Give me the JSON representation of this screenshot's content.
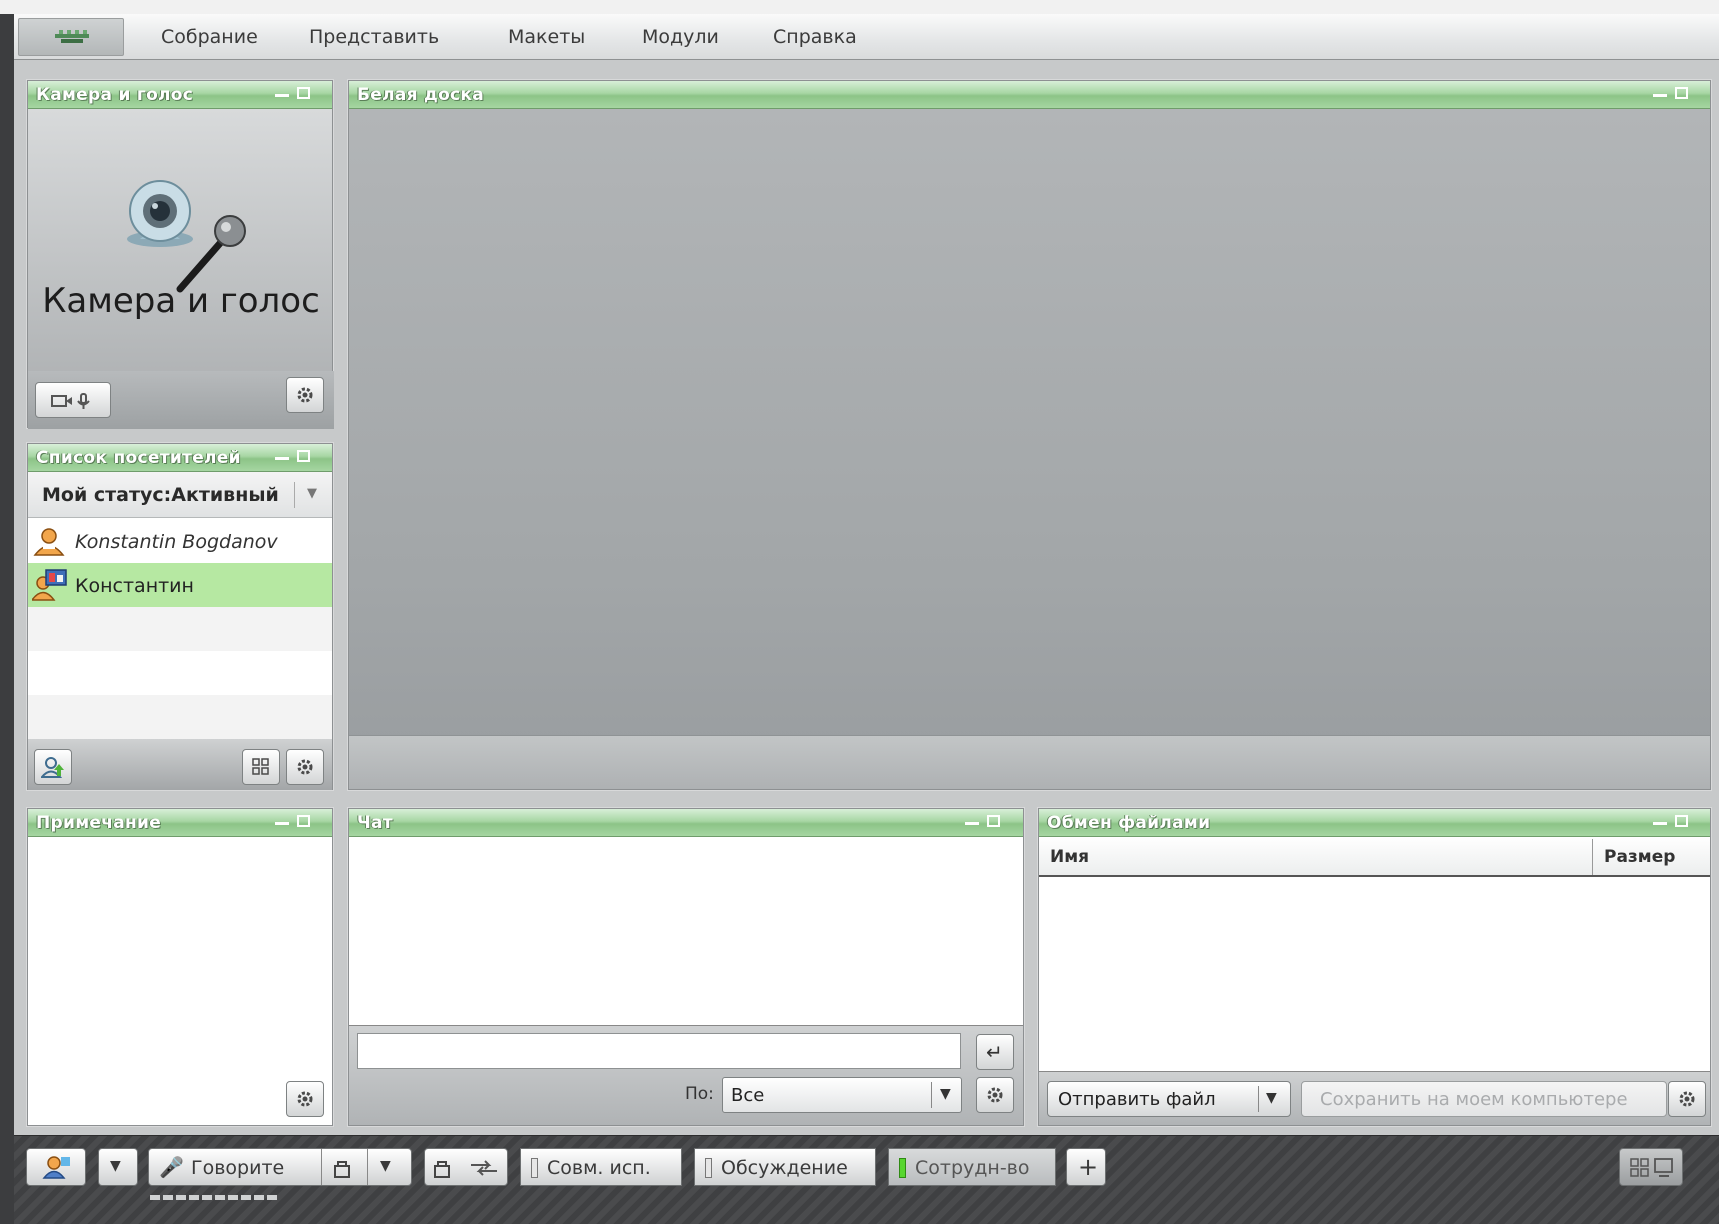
{
  "menu": {
    "items": [
      "Собрание",
      "Представить",
      "Макеты",
      "Модули",
      "Справка"
    ]
  },
  "webcam": {
    "title": "Камера и голос",
    "caption": "Камера и голос",
    "toolbar_icon": "camera-mic-icon",
    "settings_icon": "gear-icon"
  },
  "whiteboard": {
    "title": "Белая доска"
  },
  "attendees": {
    "title": "Список посетителей",
    "status_label": "Мой статус:Активный",
    "users": [
      {
        "name": "Konstantin Bogdanov",
        "italic": true,
        "highlighted": false,
        "icon": "host-user-icon"
      },
      {
        "name": "Константин",
        "italic": false,
        "highlighted": true,
        "icon": "presenter-user-icon"
      }
    ],
    "highlight_color": "#b6e8a2"
  },
  "notes": {
    "title": "Примечание"
  },
  "chat": {
    "title": "Чат",
    "input_placeholder": "",
    "to_label": "По:",
    "to_value": "Все"
  },
  "files": {
    "title": "Обмен файлами",
    "columns": [
      "Имя",
      "Размер"
    ],
    "upload_label": "Отправить файл",
    "save_label": "Сохранить на моем компьютере"
  },
  "taskbar": {
    "speak_label": "Говорите",
    "tabs": [
      "Совм. исп.",
      "Обсуждение",
      "Сотрудн-во"
    ],
    "active_tab_color": "#57d62f"
  },
  "colors": {
    "title_green": "#8cc487",
    "workspace": "#c7c9ca"
  }
}
